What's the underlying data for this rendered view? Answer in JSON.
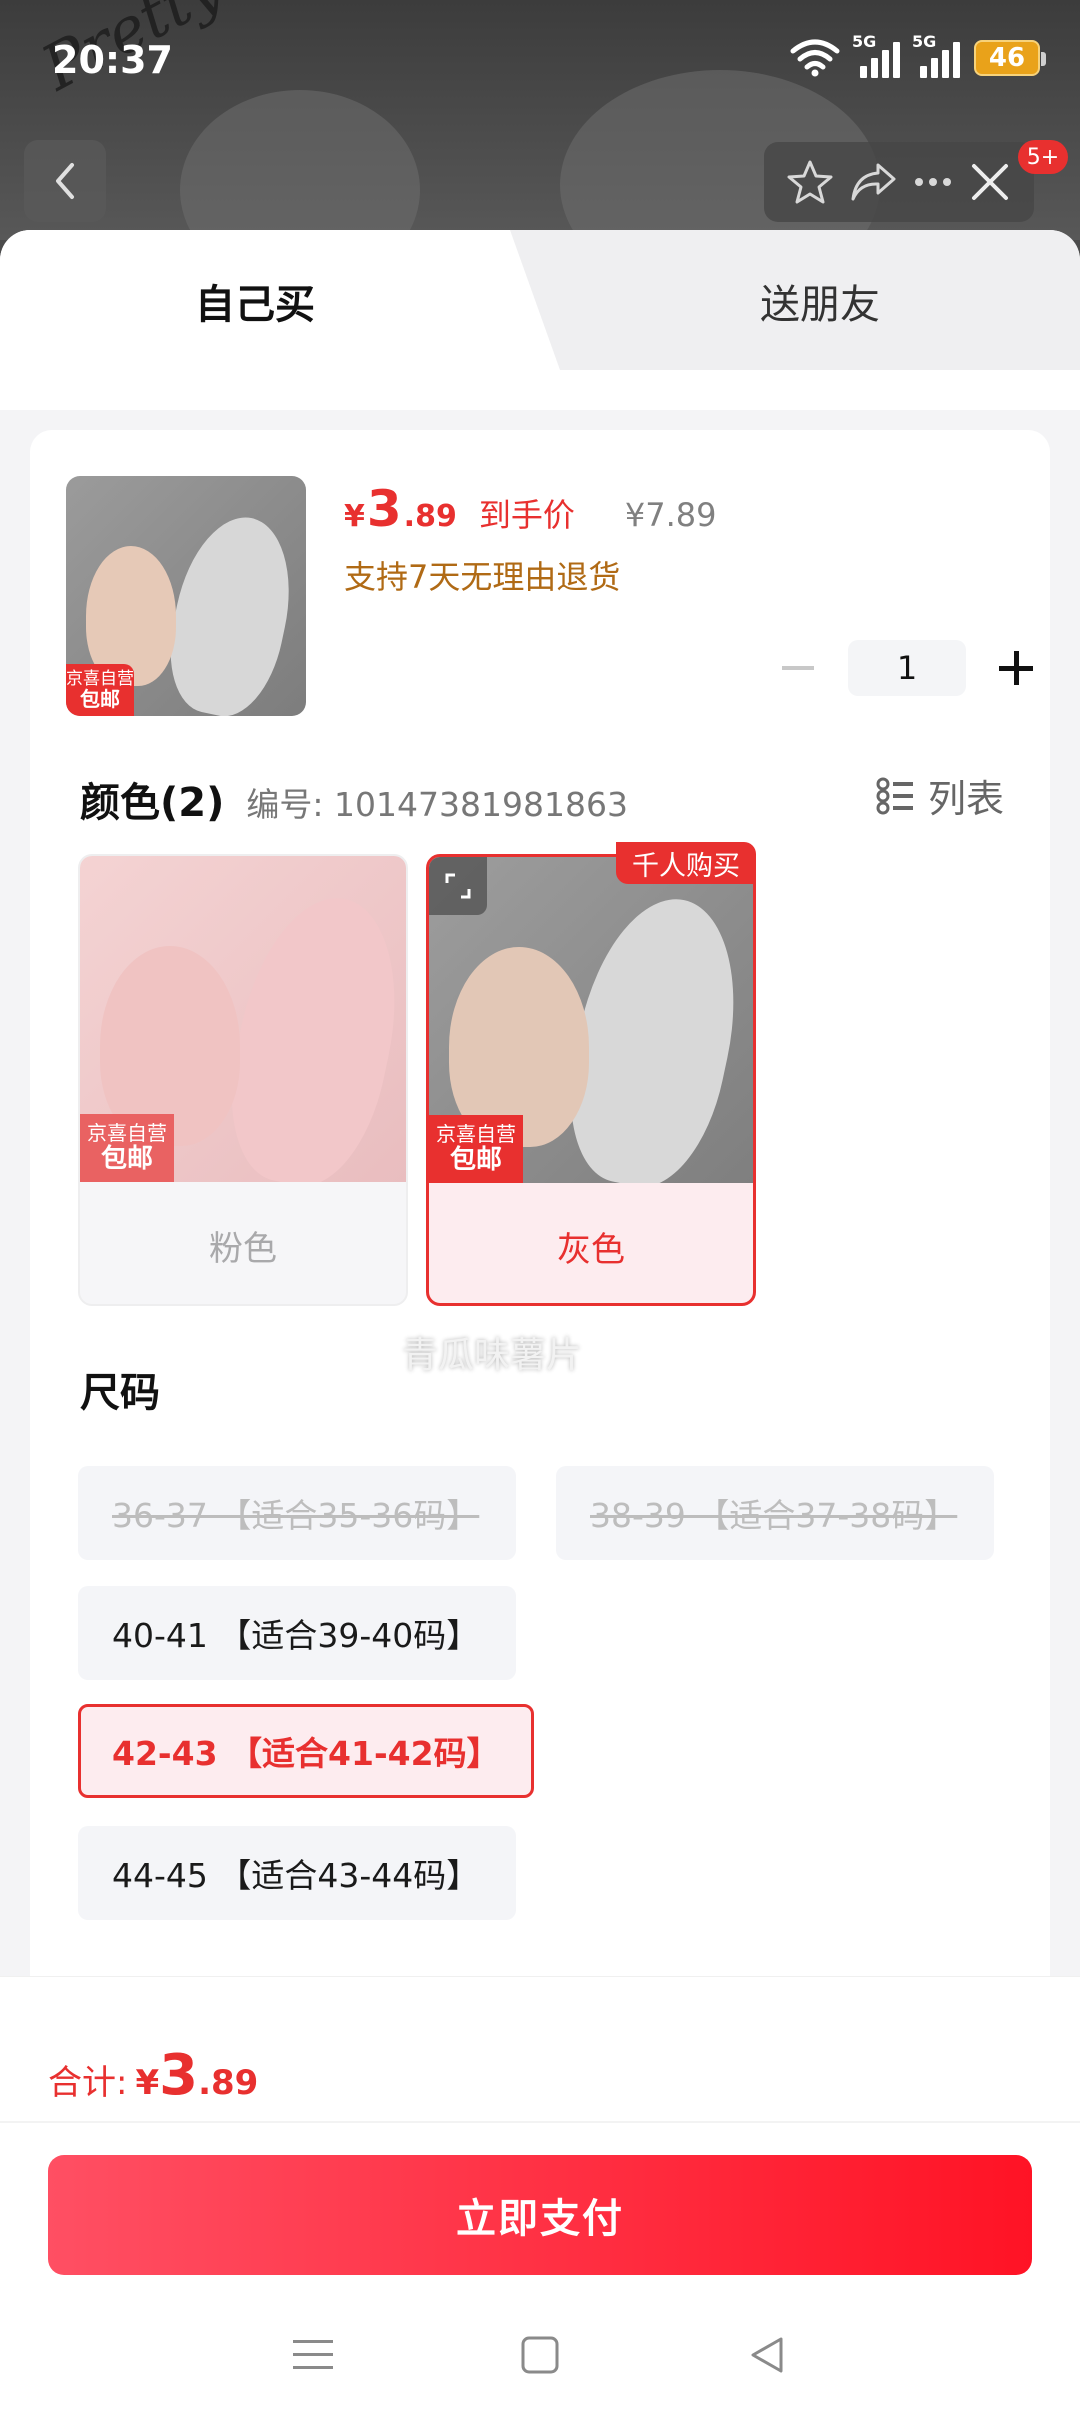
{
  "status_bar": {
    "time": "20:37",
    "net1": "5G",
    "net2": "5G",
    "battery": "46"
  },
  "backdrop": {
    "brand_script": "Pretty Sunshine"
  },
  "top_actions": {
    "badge": "5+"
  },
  "tabs": [
    {
      "label": "自己买",
      "active": true
    },
    {
      "label": "送朋友",
      "active": false
    }
  ],
  "product": {
    "thumb_tag_line1": "京喜自营",
    "thumb_tag_line2": "包邮",
    "price_symbol": "¥",
    "price_int": "3",
    "price_dec": ".89",
    "price_label": "到手价",
    "original_price": "¥7.89",
    "return_policy": "支持7天无理由退货",
    "quantity": "1"
  },
  "color_section": {
    "title": "颜色(2)",
    "sku": "编号: 10147381981863",
    "list_label": "列表",
    "hot_badge": "千人购买",
    "overlay_text": "青瓜味薯片",
    "options": [
      {
        "label": "粉色",
        "selected": false,
        "tag_line1": "京喜自营",
        "tag_line2": "包邮"
      },
      {
        "label": "灰色",
        "selected": true,
        "tag_line1": "京喜自营",
        "tag_line2": "包邮"
      }
    ]
  },
  "size_section": {
    "title": "尺码",
    "options": [
      {
        "label": "36-37 【适合35-36码】",
        "state": "disabled"
      },
      {
        "label": "38-39 【适合37-38码】",
        "state": "disabled"
      },
      {
        "label": "40-41 【适合39-40码】",
        "state": "normal"
      },
      {
        "label": "42-43 【适合41-42码】",
        "state": "selected"
      },
      {
        "label": "44-45 【适合43-44码】",
        "state": "normal"
      }
    ]
  },
  "footer": {
    "total_label": "合计:",
    "total_symbol": "¥",
    "total_int": "3",
    "total_dec": ".89",
    "pay_button": "立即支付"
  },
  "colors": {
    "accent": "#e8302f",
    "pay_gradient_start": "#ff4f63",
    "pay_gradient_end": "#ff1325",
    "return_text": "#b06a15"
  }
}
